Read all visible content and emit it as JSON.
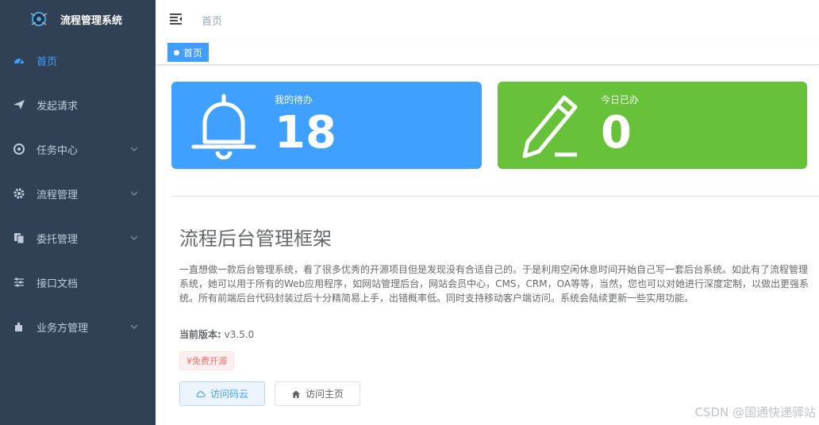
{
  "app": {
    "title": "流程管理系统"
  },
  "sidebar": {
    "items": [
      {
        "label": "首页",
        "icon": "dashboard-icon",
        "active": true,
        "expandable": false
      },
      {
        "label": "发起请求",
        "icon": "send-icon",
        "active": false,
        "expandable": false
      },
      {
        "label": "任务中心",
        "icon": "target-icon",
        "active": false,
        "expandable": true
      },
      {
        "label": "流程管理",
        "icon": "gear-icon",
        "active": false,
        "expandable": true
      },
      {
        "label": "委托管理",
        "icon": "copy-icon",
        "active": false,
        "expandable": true
      },
      {
        "label": "接口文档",
        "icon": "sliders-icon",
        "active": false,
        "expandable": false
      },
      {
        "label": "业务方管理",
        "icon": "puzzle-icon",
        "active": false,
        "expandable": true
      }
    ]
  },
  "navbar": {
    "breadcrumb": "首页"
  },
  "tags": {
    "active": "首页"
  },
  "panels": {
    "todo": {
      "label": "我的待办",
      "value": "18",
      "icon": "bell-icon"
    },
    "done": {
      "label": "今日已办",
      "value": "0",
      "icon": "pencil-icon"
    }
  },
  "content": {
    "title": "流程后台管理框架",
    "description": "一直想做一款后台管理系统，看了很多优秀的开源项目但是发现没有合适自己的。于是利用空闲休息时间开始自己写一套后台系统。如此有了流程管理系统，她可以用于所有的Web应用程序，如网站管理后台，网站会员中心，CMS，CRM，OA等等，当然，您也可以对她进行深度定制，以做出更强系统。所有前端后台代码封装过后十分精简易上手，出错概率低。同时支持移动客户端访问。系统会陆续更新一些实用功能。",
    "version_label": "当前版本:",
    "version_value": "v3.5.0",
    "free_tag": "¥免费开源",
    "btn_gitee": "访问码云",
    "btn_home": "访问主页"
  },
  "watermark": "CSDN @国通快递驿站",
  "colors": {
    "sidebar_bg": "#304156",
    "active": "#409eff",
    "panel_blue": "#40a0ff",
    "panel_green": "#67c23a"
  }
}
